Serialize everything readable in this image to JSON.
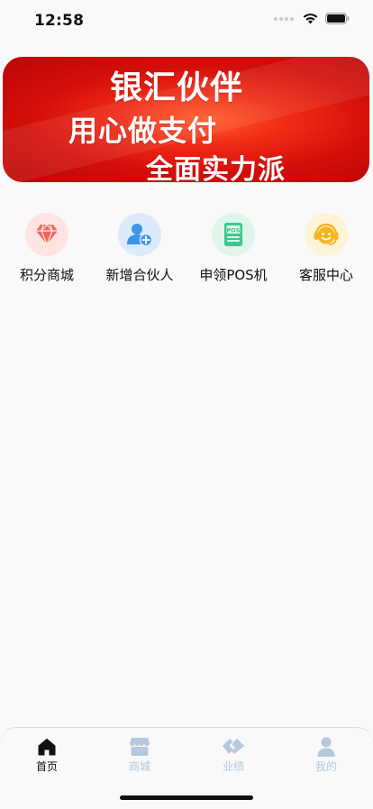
{
  "status_bar": {
    "time": "12:58"
  },
  "banner": {
    "line1": "银汇伙伴",
    "line2": "用心做支付",
    "line3": "全面实力派"
  },
  "quick_entries": [
    {
      "label": "积分商城",
      "icon": "diamond-icon",
      "color": "#f2685e",
      "bg": "#fde4e2"
    },
    {
      "label": "新增合伙人",
      "icon": "add-user-icon",
      "color": "#3d94ec",
      "bg": "#dcebfb"
    },
    {
      "label": "申领POS机",
      "icon": "pos-icon",
      "color": "#39c98a",
      "bg": "#dff5ea"
    },
    {
      "label": "客服中心",
      "icon": "customer-service-icon",
      "color": "#f5b521",
      "bg": "#fdf3d6"
    }
  ],
  "tabs": [
    {
      "label": "首页",
      "icon": "home-icon",
      "active": true
    },
    {
      "label": "商城",
      "icon": "store-icon",
      "active": false
    },
    {
      "label": "业绩",
      "icon": "handshake-icon",
      "active": false
    },
    {
      "label": "我的",
      "icon": "person-icon",
      "active": false
    }
  ],
  "colors": {
    "banner_red": "#d40f0a",
    "tab_active": "#111111",
    "tab_inactive": "#b6c8de"
  }
}
